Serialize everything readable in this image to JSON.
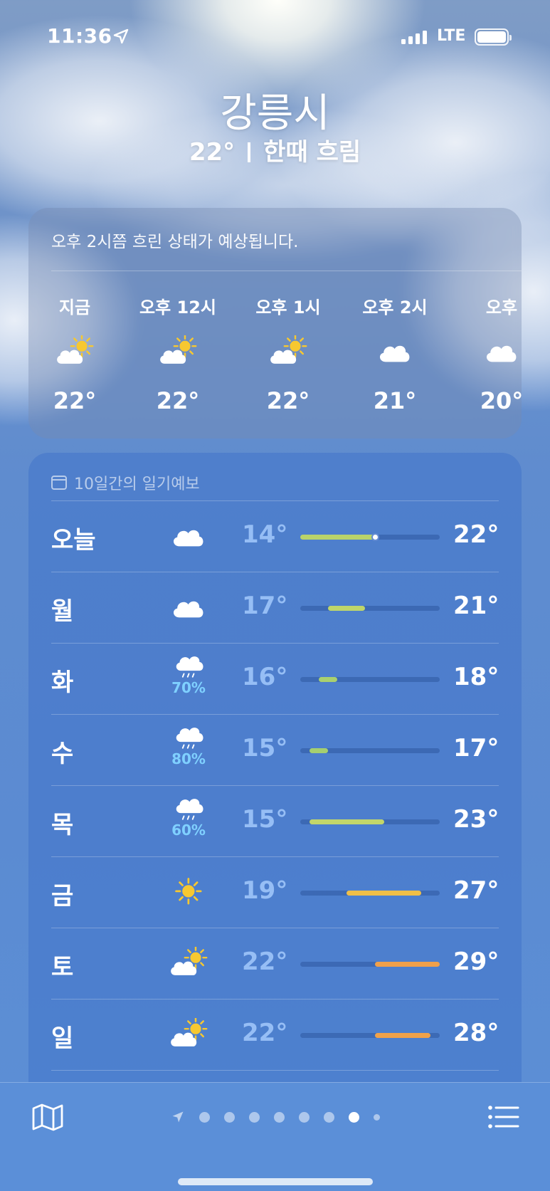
{
  "status_bar": {
    "time": "11:36",
    "carrier": "LTE",
    "icons": [
      "location-arrow-icon",
      "signal-icon",
      "battery-icon"
    ]
  },
  "header": {
    "city": "강릉시",
    "temperature": "22°",
    "condition": "한때 흐림"
  },
  "hourly": {
    "summary": "오후 2시쯤 흐린 상태가 예상됩니다.",
    "items": [
      {
        "label": "지금",
        "icon": "partly-sunny-icon",
        "temp": "22°"
      },
      {
        "label": "오후 12시",
        "icon": "partly-sunny-icon",
        "temp": "22°"
      },
      {
        "label": "오후 1시",
        "icon": "partly-sunny-icon",
        "temp": "22°"
      },
      {
        "label": "오후 2시",
        "icon": "cloud-icon",
        "temp": "21°"
      },
      {
        "label": "오후",
        "icon": "cloud-icon",
        "temp": "20°"
      }
    ]
  },
  "daily": {
    "header": "10일간의 일기예보",
    "range_min": 14,
    "range_max": 29,
    "days": [
      {
        "day": "오늘",
        "icon": "cloud-icon",
        "precip": "",
        "low": "14°",
        "high": "22°",
        "low_v": 14,
        "high_v": 22,
        "color": "#b9d36a",
        "current": 22
      },
      {
        "day": "월",
        "icon": "cloud-icon",
        "precip": "",
        "low": "17°",
        "high": "21°",
        "low_v": 17,
        "high_v": 21,
        "color": "#bfd66a"
      },
      {
        "day": "화",
        "icon": "rain-cloud-icon",
        "precip": "70%",
        "low": "16°",
        "high": "18°",
        "low_v": 16,
        "high_v": 18,
        "color": "#a9d06f"
      },
      {
        "day": "수",
        "icon": "rain-cloud-icon",
        "precip": "80%",
        "low": "15°",
        "high": "17°",
        "low_v": 15,
        "high_v": 17,
        "color": "#a5cf70"
      },
      {
        "day": "목",
        "icon": "rain-cloud-icon",
        "precip": "60%",
        "low": "15°",
        "high": "23°",
        "low_v": 15,
        "high_v": 23,
        "color": "#c3d66a"
      },
      {
        "day": "금",
        "icon": "sun-icon",
        "precip": "",
        "low": "19°",
        "high": "27°",
        "low_v": 19,
        "high_v": 27,
        "color": "#f0bf48"
      },
      {
        "day": "토",
        "icon": "partly-sunny-icon",
        "precip": "",
        "low": "22°",
        "high": "29°",
        "low_v": 22,
        "high_v": 29,
        "color": "#f0a04a"
      },
      {
        "day": "일",
        "icon": "partly-sunny-icon",
        "precip": "",
        "low": "22°",
        "high": "28°",
        "low_v": 22,
        "high_v": 28,
        "color": "#f0a24a"
      }
    ]
  },
  "bottom_bar": {
    "left_icon": "map-icon",
    "right_icon": "list-icon",
    "page_count": 9,
    "active_page": 7
  }
}
